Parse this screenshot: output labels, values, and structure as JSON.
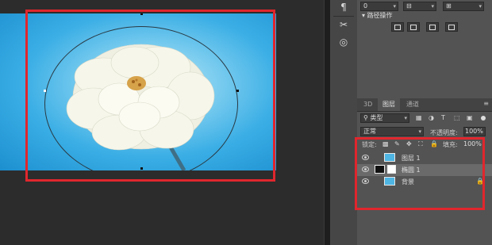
{
  "panel": {
    "path_ops_label": "路径操作",
    "top_dropdowns": [
      "0",
      "",
      ""
    ]
  },
  "tabs": [
    {
      "label": "3D",
      "active": false
    },
    {
      "label": "图层",
      "active": true
    },
    {
      "label": "通道",
      "active": false
    }
  ],
  "filter": {
    "kind_label": "类型"
  },
  "blend": {
    "mode": "正常",
    "opacity_label": "不透明度:",
    "opacity_value": "100%"
  },
  "lock": {
    "lock_label": "锁定:",
    "fill_label": "填充:",
    "fill_value": "100%"
  },
  "layers": [
    {
      "name": "图层 1",
      "selected": false,
      "locked": false
    },
    {
      "name": "椭圆 1",
      "selected": true,
      "locked": false
    },
    {
      "name": "背景",
      "selected": false,
      "locked": true
    }
  ],
  "colors": {
    "annotation_red": "#e0262d",
    "sky_blue": "#3aaee5",
    "panel_bg": "#535353"
  }
}
